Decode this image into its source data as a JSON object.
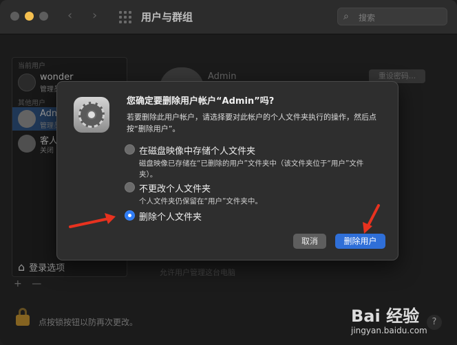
{
  "window": {
    "title": "用户与群组"
  },
  "toolbar": {
    "back_glyph": "‹",
    "forward_glyph": "›",
    "search_placeholder": "搜索"
  },
  "sidebar": {
    "current_user_header": "当前用户",
    "other_users_header": "其他用户",
    "users": [
      {
        "name": "wonder",
        "role": "管理员"
      },
      {
        "name": "Admin",
        "role": "管理员"
      },
      {
        "name": "客人用户",
        "role": "关闭"
      }
    ],
    "login_options": "登录选项",
    "add_glyph": "+",
    "remove_glyph": "—"
  },
  "background": {
    "admin_name": "Admin",
    "reset_password_button": "重设密码...",
    "checkbox_label": "允许用户管理这台电脑"
  },
  "bottom": {
    "lock_text": "点按锁按钮以防再次更改。",
    "help_glyph": "?"
  },
  "dialog": {
    "title": "您确定要删除用户帐户“Admin”吗?",
    "body": "若要删除此用户帐户，请选择要对此帐户的个人文件夹执行的操作，然后点按“删除用户”。",
    "options": [
      {
        "label": "在磁盘映像中存储个人文件夹",
        "desc": "磁盘映像已存储在“已删除的用户”文件夹中（该文件夹位于“用户”文件夹）。",
        "selected": false
      },
      {
        "label": "不更改个人文件夹",
        "desc": "个人文件夹仍保留在“用户”文件夹中。",
        "selected": false
      },
      {
        "label": "删除个人文件夹",
        "desc": "",
        "selected": true
      }
    ],
    "cancel_button": "取消",
    "delete_button": "删除用户"
  },
  "watermark": {
    "main": "Bai 经验",
    "sub": "jingyan.baidu.com"
  },
  "colors": {
    "accent": "#2f6fd8",
    "annotation": "#e8321f",
    "traffic_yellow": "#f4bf4f"
  }
}
